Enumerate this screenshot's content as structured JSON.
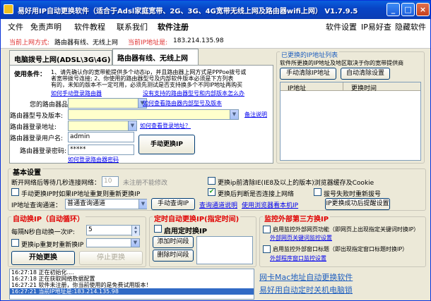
{
  "window": {
    "title": "易好用IP自动更换软件（适合于Adsl家庭宽带、2G、3G、4G宽带无线上网及路由器wifi上网） V1.7.9.5",
    "min": "_",
    "max": "□",
    "close": "×"
  },
  "menu": {
    "items": [
      "文件",
      "免责声明",
      "软件教程",
      "联系我们",
      "软件注册"
    ],
    "right": [
      "软件设置",
      "IP易好查",
      "隐藏软件"
    ]
  },
  "info": {
    "mode_label": "当前上网方式:",
    "mode_value": "路由器有线、无线上网",
    "ip_label": "当前IP地址是:",
    "ip_value": "183.214.135.98"
  },
  "tabs": [
    "电脑拨号上网(ADSL\\3G\\4G)",
    "路由器有线、无线上网"
  ],
  "router": {
    "conditions_label": "使用条件：",
    "conditions_text": [
      "1、请先确认你的宽带能提供多个动态ip，并且路由器上网方式是PPPoe拨号或",
      "者宽带拨号连接;   2、你使用的路由器型号及内部软件版本必须是下方列表",
      "有的，未知的版本不一定可用，必须先测试是否支持换多个不同IP地址再购买"
    ],
    "link_login": "如何手动登录路由器",
    "link_supported": "没有支持的路由器型号和内部版本怎么办",
    "brand_label": "您的路由器品牌:",
    "link_check_model": "如何查看路由器内部型号及版本",
    "model_label": "路由器型号及版本:",
    "link_remark": "备注说明",
    "addr_label": "路由器登录地址:",
    "link_check_addr": "如何查看登录地址？",
    "user_label": "路由器登录用户名:",
    "user_value": "admin",
    "pass_label": "路由器登录密码:",
    "pass_value": "*****",
    "change_btn": "手动更换IP",
    "link_login2": "如何登录路由器密码"
  },
  "history": {
    "title": "已更换的IP地址列表",
    "desc": "软件所更换的IP地址及地区取决于你的宽带提供商",
    "clear_btn": "手动清除IP地址",
    "auto_btn": "自动清除设置",
    "col_ip": "IP地址",
    "col_time": "更换时间"
  },
  "basic": {
    "title": "基本设置",
    "reconnect_label": "断开网络后等待几秒连接网络：",
    "reconnect_value": "10",
    "reconnect_hint": "未注册不能修改",
    "clear_ie_label": "更换ip前清除IE(IE8及以上的版本)浏览器缓存及Cookie",
    "manual_ip_label": "手动更换IP时如果IP地址重复则重新更换IP",
    "check_net_label": "更换后判断是否连接上网络",
    "redial_label": "拔号失败时重新拔号",
    "query_label": "IP地址查询通道：",
    "query_value": "普通查询通道",
    "query_btn": "手动查询IP",
    "query_link": "查询通道说明",
    "browser_link": "使用浏览器看本机IP",
    "remind_btn": "IP更换成功后提醒设置"
  },
  "auto": {
    "title": "自动换IP（自动循环）",
    "interval_label": "每隔N秒自动换一次IP:",
    "interval_value": "5",
    "repeat_label": "更换ip重复时重新换IP",
    "start_btn": "开始更换",
    "stop_btn": "停止更换"
  },
  "timed": {
    "title": "定时自动更换IP(指定时间)",
    "enable_label": "启用定时换IP",
    "add_btn": "添加时间段",
    "del_btn": "删除时间段"
  },
  "monitor": {
    "title": "监控外部第三方换IP",
    "web_label": "启用监控外部网页功能（即网页上出现指定关键词时换IP）",
    "web_link": "外部网页关键词监控设置",
    "win_label": "启用监控外部窗口标题（即出现指定窗口标题时换IP）",
    "win_link": "外部程序窗口监控设置"
  },
  "log": [
    "16:27:18  正在初始化....",
    "16:27:18  正在获取网络数据配置",
    "16:27:21  软件未注册，你当前使用的是免费试用版本！",
    "16:27:21  当前IP地址是:183.214.135.98"
  ],
  "ads": [
    "网卡Mac地址自动更换软件",
    "易好用自动定时关机电脑锁"
  ]
}
